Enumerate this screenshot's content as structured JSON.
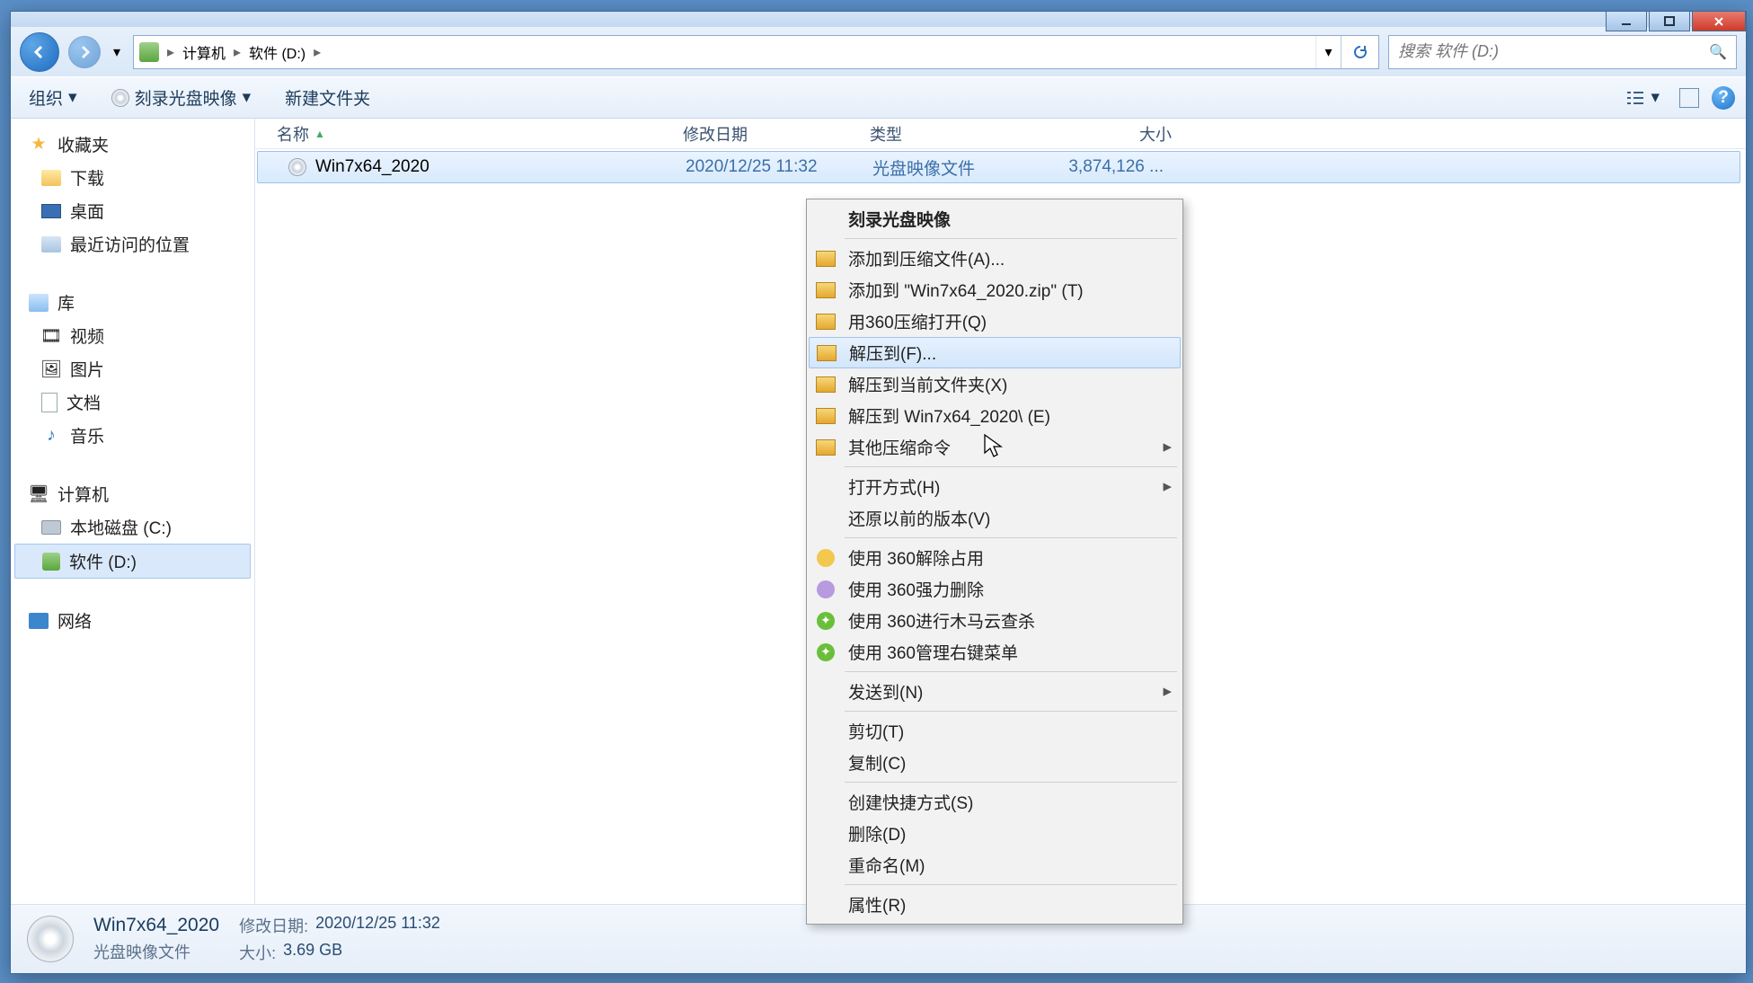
{
  "breadcrumb": {
    "root_icon": "drive",
    "items": [
      "计算机",
      "软件 (D:)"
    ]
  },
  "search": {
    "placeholder": "搜索 软件 (D:)"
  },
  "toolbar": {
    "organize": "组织",
    "burn": "刻录光盘映像",
    "newfolder": "新建文件夹"
  },
  "columns": {
    "name": "名称",
    "date": "修改日期",
    "type": "类型",
    "size": "大小"
  },
  "sidebar": {
    "favorites": {
      "label": "收藏夹",
      "items": [
        "下载",
        "桌面",
        "最近访问的位置"
      ]
    },
    "libraries": {
      "label": "库",
      "items": [
        "视频",
        "图片",
        "文档",
        "音乐"
      ]
    },
    "computer": {
      "label": "计算机",
      "items": [
        "本地磁盘 (C:)",
        "软件 (D:)"
      ]
    },
    "network": {
      "label": "网络"
    }
  },
  "file": {
    "name": "Win7x64_2020",
    "date": "2020/12/25 11:32",
    "type": "光盘映像文件",
    "size": "3,874,126 ..."
  },
  "context_menu": {
    "burn": "刻录光盘映像",
    "add_archive": "添加到压缩文件(A)...",
    "add_zip": "添加到 \"Win7x64_2020.zip\" (T)",
    "open_360zip": "用360压缩打开(Q)",
    "extract_to": "解压到(F)...",
    "extract_here": "解压到当前文件夹(X)",
    "extract_named": "解压到 Win7x64_2020\\ (E)",
    "other_zip": "其他压缩命令",
    "open_with": "打开方式(H)",
    "restore_prev": "还原以前的版本(V)",
    "unlock360": "使用 360解除占用",
    "forcedel360": "使用 360强力删除",
    "scan360": "使用 360进行木马云查杀",
    "ctx360menu": "使用 360管理右键菜单",
    "send_to": "发送到(N)",
    "cut": "剪切(T)",
    "copy": "复制(C)",
    "shortcut": "创建快捷方式(S)",
    "delete": "删除(D)",
    "rename": "重命名(M)",
    "properties": "属性(R)"
  },
  "status": {
    "title": "Win7x64_2020",
    "subtitle": "光盘映像文件",
    "date_label": "修改日期:",
    "date": "2020/12/25 11:32",
    "size_label": "大小:",
    "size": "3.69 GB"
  }
}
